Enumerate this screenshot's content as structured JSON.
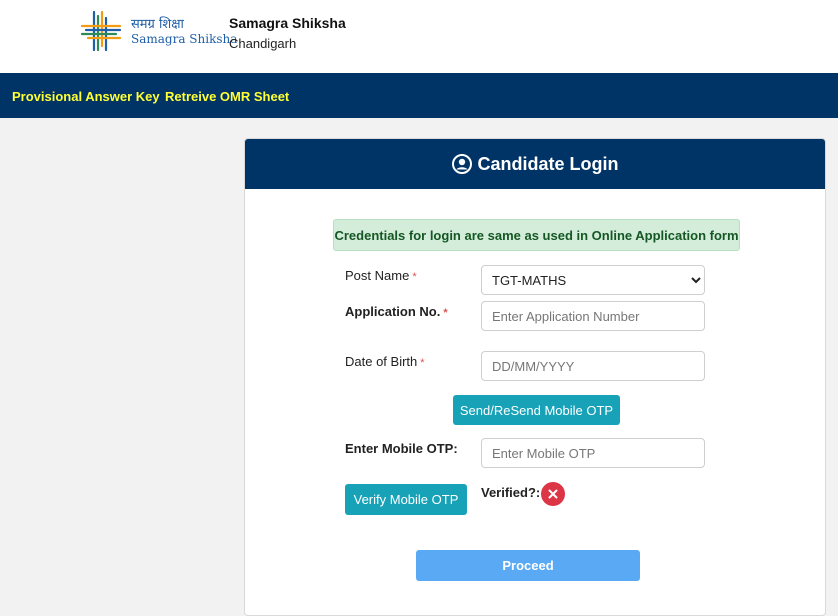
{
  "header": {
    "logo_hindi": "समग्र शिक्षा",
    "logo_english": "Samagra Shiksha",
    "org_name": "Samagra Shiksha",
    "org_location": "Chandigarh"
  },
  "nav": {
    "items": [
      {
        "label": "Provisional Answer Key"
      },
      {
        "label": "Retreive OMR Sheet"
      }
    ]
  },
  "login": {
    "title": "Candidate Login",
    "notice": "Credentials for login are same as used in Online Application form",
    "post_name_label": "Post Name",
    "post_name_value": "TGT-MATHS",
    "application_label": "Application No.",
    "application_placeholder": "Enter Application Number",
    "dob_label": "Date of Birth",
    "dob_placeholder": "DD/MM/YYYY",
    "send_otp_label": "Send/ReSend Mobile OTP",
    "otp_label": "Enter Mobile OTP:",
    "otp_placeholder": "Enter Mobile OTP",
    "verify_otp_label": "Verify Mobile OTP",
    "verified_label": "Verified?:",
    "required_marker": "*",
    "proceed_label": "Proceed"
  },
  "colors": {
    "navy": "#003366",
    "nav_link": "#ffff33",
    "teal": "#17a2b8",
    "proceed": "#5aa9f5",
    "alert_bg": "#d4edda",
    "error": "#dc3545"
  },
  "icons": {
    "title_icon": "user-circle-icon",
    "status_icon": "close-circle-icon"
  }
}
